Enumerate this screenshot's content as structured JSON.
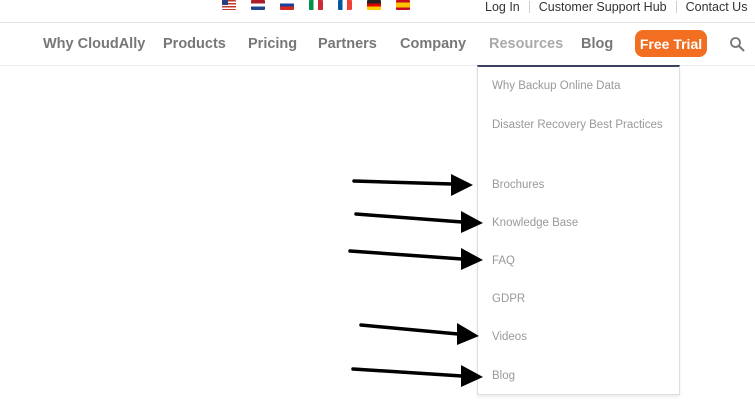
{
  "topbar": {
    "flags": [
      "flag-us-icon",
      "flag-nl-icon",
      "flag-ru-icon",
      "flag-it-icon",
      "flag-fr-icon",
      "flag-de-icon",
      "flag-es-icon"
    ],
    "links": [
      "Log In",
      "Customer Support Hub",
      "Contact Us"
    ]
  },
  "nav": {
    "items": [
      "Why CloudAlly",
      "Products",
      "Pricing",
      "Partners",
      "Company",
      "Resources",
      "Blog"
    ],
    "active": "Resources",
    "cta": "Free Trial",
    "search_icon": "search-icon"
  },
  "dropdown": {
    "items": [
      "Why Backup Online Data",
      "Disaster Recovery Best Practices",
      "Brochures",
      "Knowledge Base",
      "FAQ",
      "GDPR",
      "Videos",
      "Blog"
    ]
  },
  "annotations": {
    "arrows_point_to": [
      "Brochures",
      "Knowledge Base",
      "FAQ",
      "Videos",
      "Blog"
    ]
  },
  "colors": {
    "cta_background": "#f26f21",
    "dropdown_top_border": "#3a4260",
    "nav_text": "#777777",
    "dropdown_text": "#999999"
  }
}
